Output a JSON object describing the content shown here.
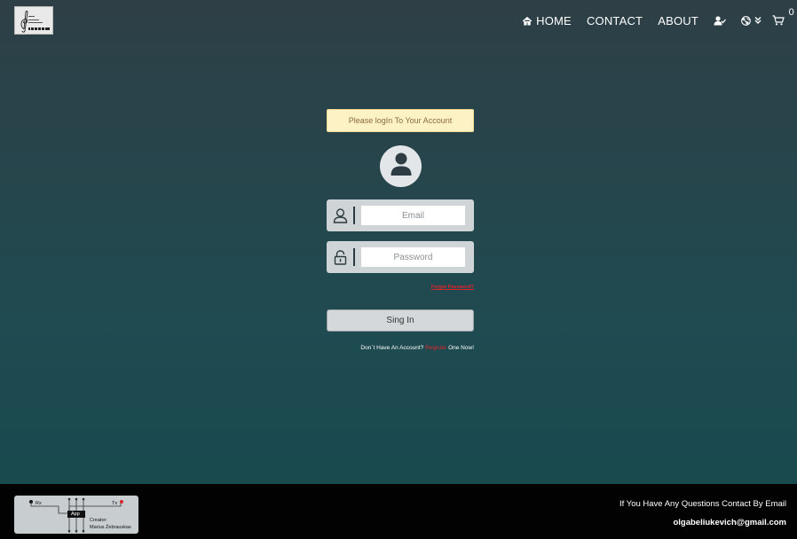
{
  "header": {
    "nav": {
      "home": "HOME",
      "contact": "CONTACT",
      "about": "ABOUT"
    },
    "cart_count": "0",
    "icons": [
      "home-icon",
      "user-check-icon",
      "globe-icon",
      "chevron-down-icon",
      "cart-icon"
    ]
  },
  "login": {
    "alert": "Please logIn To Your Account",
    "email_placeholder": "Email",
    "password_placeholder": "Password",
    "forgot": "Forgot Password?",
    "signin": "Sing In",
    "register_prefix": "Don`t Have An Account?",
    "register_link": "Register",
    "register_suffix": "One Now!"
  },
  "footer": {
    "credit_rx": "Rx",
    "credit_tx": "Tx",
    "credit_app": "App",
    "creator_label": "Creator:",
    "creator_name": "Marius Žebrauskas",
    "contact_text": "If You Have Any Questions Contact By Email",
    "email": "olgabeliukevich@gmail.com"
  },
  "colors": {
    "alert_bg": "#fdf1c6",
    "alert_text": "#8a6d3b",
    "link_red": "#d9262c",
    "footer_bg": "#020202"
  }
}
